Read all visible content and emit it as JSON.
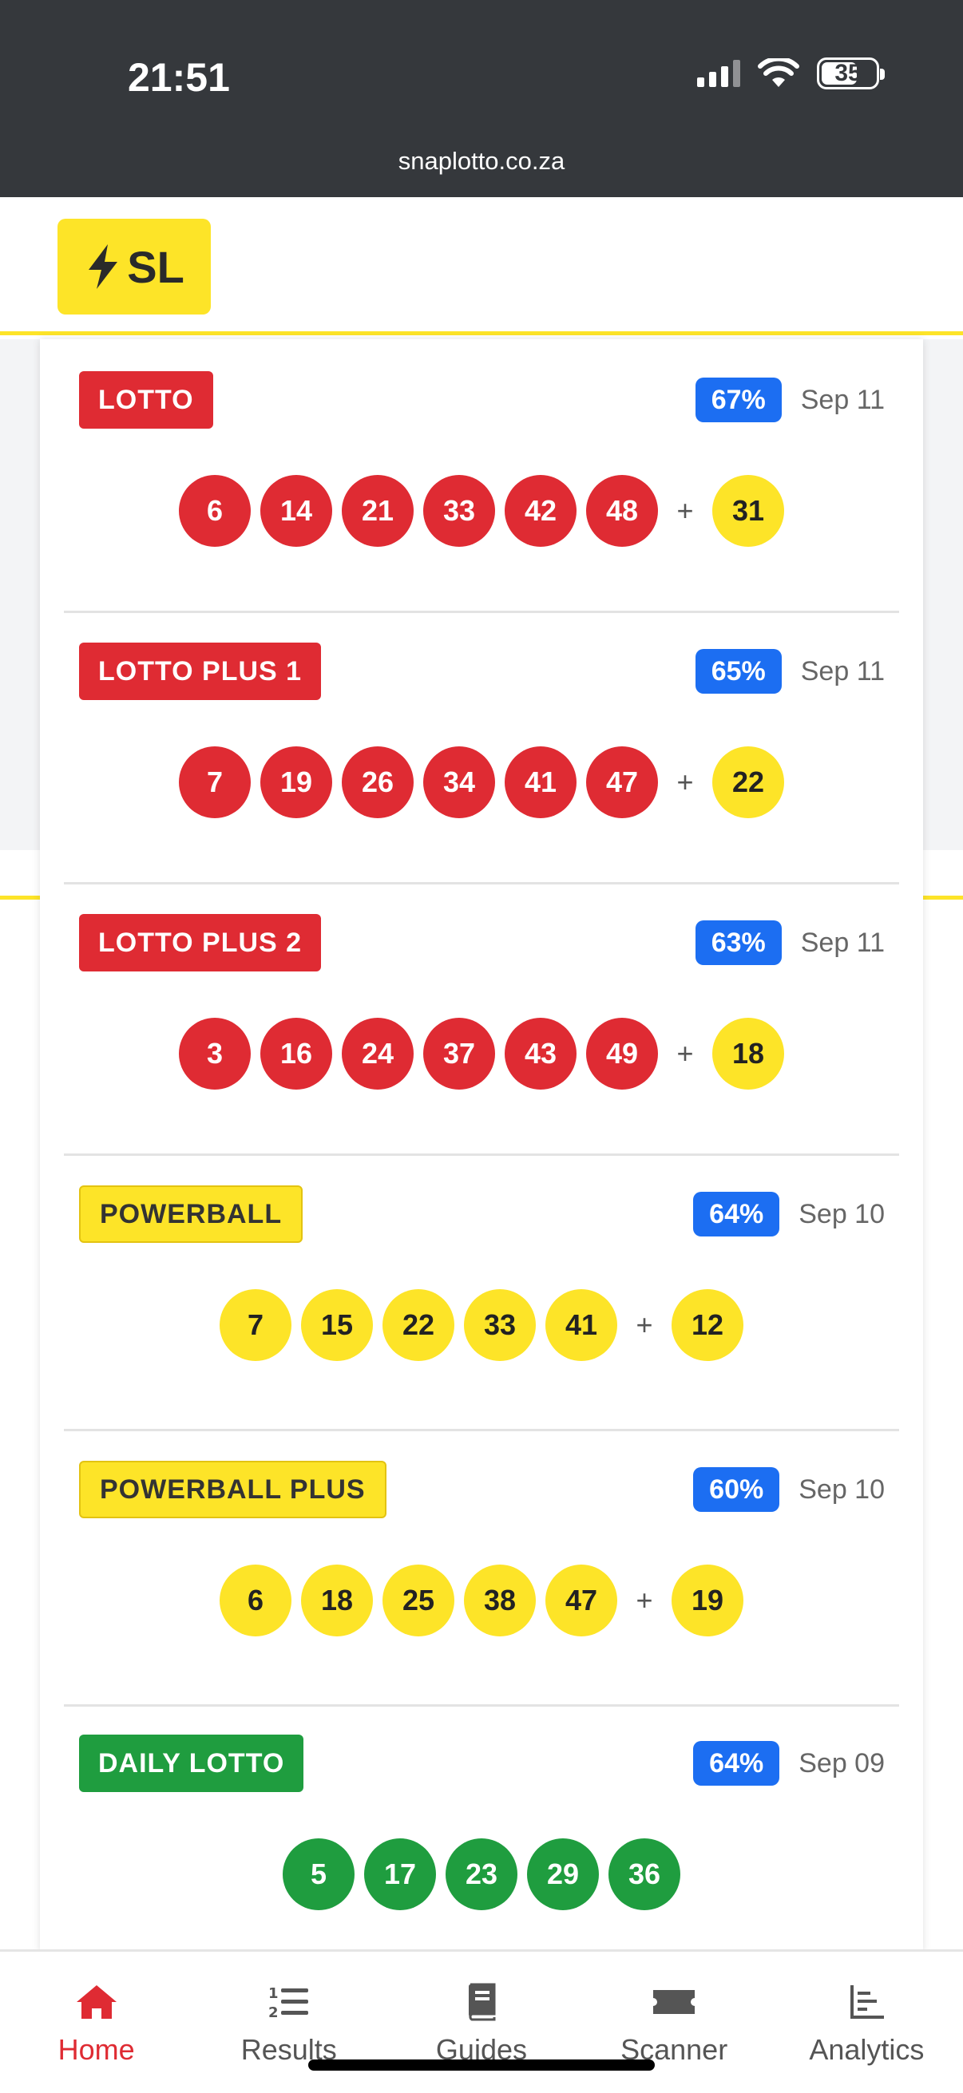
{
  "status_bar": {
    "time": "21:51",
    "battery": "35"
  },
  "browser": {
    "url": "snaplotto.co.za"
  },
  "header": {
    "logo_text": "SL"
  },
  "draws": [
    {
      "name": "LOTTO",
      "color": "red",
      "percent": "67%",
      "date": "Sep 11",
      "numbers": [
        "6",
        "14",
        "21",
        "33",
        "42",
        "48"
      ],
      "bonus": "31",
      "bonus_color": "yellow"
    },
    {
      "name": "LOTTO PLUS 1",
      "color": "red",
      "percent": "65%",
      "date": "Sep 11",
      "numbers": [
        "7",
        "19",
        "26",
        "34",
        "41",
        "47"
      ],
      "bonus": "22",
      "bonus_color": "yellow"
    },
    {
      "name": "LOTTO PLUS 2",
      "color": "red",
      "percent": "63%",
      "date": "Sep 11",
      "numbers": [
        "3",
        "16",
        "24",
        "37",
        "43",
        "49"
      ],
      "bonus": "18",
      "bonus_color": "yellow"
    },
    {
      "name": "POWERBALL",
      "color": "yellow",
      "percent": "64%",
      "date": "Sep 10",
      "numbers": [
        "7",
        "15",
        "22",
        "33",
        "41"
      ],
      "bonus": "12",
      "bonus_color": "yellow"
    },
    {
      "name": "POWERBALL PLUS",
      "color": "yellow",
      "percent": "60%",
      "date": "Sep 10",
      "numbers": [
        "6",
        "18",
        "25",
        "38",
        "47"
      ],
      "bonus": "19",
      "bonus_color": "yellow"
    },
    {
      "name": "DAILY LOTTO",
      "color": "green",
      "percent": "64%",
      "date": "Sep 09",
      "numbers": [
        "5",
        "17",
        "23",
        "29",
        "36"
      ],
      "bonus": null,
      "bonus_color": null
    }
  ],
  "plus_symbol": "+",
  "nav": {
    "items": [
      {
        "label": "Home",
        "icon": "home-icon",
        "active": true
      },
      {
        "label": "Results",
        "icon": "list-numbered-icon",
        "active": false
      },
      {
        "label": "Guides",
        "icon": "book-icon",
        "active": false
      },
      {
        "label": "Scanner",
        "icon": "ticket-icon",
        "active": false
      },
      {
        "label": "Analytics",
        "icon": "chart-icon",
        "active": false
      }
    ]
  },
  "colors": {
    "red": "#df2b33",
    "yellow": "#fde428",
    "green": "#1f9d3f",
    "blue": "#1c6ef2"
  }
}
